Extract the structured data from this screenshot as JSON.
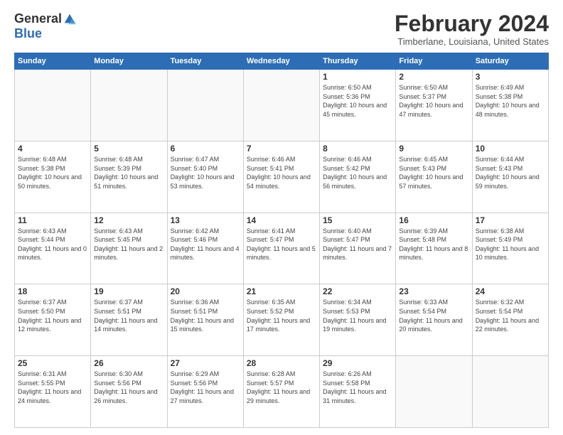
{
  "logo": {
    "general": "General",
    "blue": "Blue"
  },
  "title": "February 2024",
  "subtitle": "Timberlane, Louisiana, United States",
  "headers": [
    "Sunday",
    "Monday",
    "Tuesday",
    "Wednesday",
    "Thursday",
    "Friday",
    "Saturday"
  ],
  "weeks": [
    [
      {
        "day": "",
        "info": ""
      },
      {
        "day": "",
        "info": ""
      },
      {
        "day": "",
        "info": ""
      },
      {
        "day": "",
        "info": ""
      },
      {
        "day": "1",
        "info": "Sunrise: 6:50 AM\nSunset: 5:36 PM\nDaylight: 10 hours\nand 45 minutes."
      },
      {
        "day": "2",
        "info": "Sunrise: 6:50 AM\nSunset: 5:37 PM\nDaylight: 10 hours\nand 47 minutes."
      },
      {
        "day": "3",
        "info": "Sunrise: 6:49 AM\nSunset: 5:38 PM\nDaylight: 10 hours\nand 48 minutes."
      }
    ],
    [
      {
        "day": "4",
        "info": "Sunrise: 6:48 AM\nSunset: 5:38 PM\nDaylight: 10 hours\nand 50 minutes."
      },
      {
        "day": "5",
        "info": "Sunrise: 6:48 AM\nSunset: 5:39 PM\nDaylight: 10 hours\nand 51 minutes."
      },
      {
        "day": "6",
        "info": "Sunrise: 6:47 AM\nSunset: 5:40 PM\nDaylight: 10 hours\nand 53 minutes."
      },
      {
        "day": "7",
        "info": "Sunrise: 6:46 AM\nSunset: 5:41 PM\nDaylight: 10 hours\nand 54 minutes."
      },
      {
        "day": "8",
        "info": "Sunrise: 6:46 AM\nSunset: 5:42 PM\nDaylight: 10 hours\nand 56 minutes."
      },
      {
        "day": "9",
        "info": "Sunrise: 6:45 AM\nSunset: 5:43 PM\nDaylight: 10 hours\nand 57 minutes."
      },
      {
        "day": "10",
        "info": "Sunrise: 6:44 AM\nSunset: 5:43 PM\nDaylight: 10 hours\nand 59 minutes."
      }
    ],
    [
      {
        "day": "11",
        "info": "Sunrise: 6:43 AM\nSunset: 5:44 PM\nDaylight: 11 hours\nand 0 minutes."
      },
      {
        "day": "12",
        "info": "Sunrise: 6:43 AM\nSunset: 5:45 PM\nDaylight: 11 hours\nand 2 minutes."
      },
      {
        "day": "13",
        "info": "Sunrise: 6:42 AM\nSunset: 5:46 PM\nDaylight: 11 hours\nand 4 minutes."
      },
      {
        "day": "14",
        "info": "Sunrise: 6:41 AM\nSunset: 5:47 PM\nDaylight: 11 hours\nand 5 minutes."
      },
      {
        "day": "15",
        "info": "Sunrise: 6:40 AM\nSunset: 5:47 PM\nDaylight: 11 hours\nand 7 minutes."
      },
      {
        "day": "16",
        "info": "Sunrise: 6:39 AM\nSunset: 5:48 PM\nDaylight: 11 hours\nand 8 minutes."
      },
      {
        "day": "17",
        "info": "Sunrise: 6:38 AM\nSunset: 5:49 PM\nDaylight: 11 hours\nand 10 minutes."
      }
    ],
    [
      {
        "day": "18",
        "info": "Sunrise: 6:37 AM\nSunset: 5:50 PM\nDaylight: 11 hours\nand 12 minutes."
      },
      {
        "day": "19",
        "info": "Sunrise: 6:37 AM\nSunset: 5:51 PM\nDaylight: 11 hours\nand 14 minutes."
      },
      {
        "day": "20",
        "info": "Sunrise: 6:36 AM\nSunset: 5:51 PM\nDaylight: 11 hours\nand 15 minutes."
      },
      {
        "day": "21",
        "info": "Sunrise: 6:35 AM\nSunset: 5:52 PM\nDaylight: 11 hours\nand 17 minutes."
      },
      {
        "day": "22",
        "info": "Sunrise: 6:34 AM\nSunset: 5:53 PM\nDaylight: 11 hours\nand 19 minutes."
      },
      {
        "day": "23",
        "info": "Sunrise: 6:33 AM\nSunset: 5:54 PM\nDaylight: 11 hours\nand 20 minutes."
      },
      {
        "day": "24",
        "info": "Sunrise: 6:32 AM\nSunset: 5:54 PM\nDaylight: 11 hours\nand 22 minutes."
      }
    ],
    [
      {
        "day": "25",
        "info": "Sunrise: 6:31 AM\nSunset: 5:55 PM\nDaylight: 11 hours\nand 24 minutes."
      },
      {
        "day": "26",
        "info": "Sunrise: 6:30 AM\nSunset: 5:56 PM\nDaylight: 11 hours\nand 26 minutes."
      },
      {
        "day": "27",
        "info": "Sunrise: 6:29 AM\nSunset: 5:56 PM\nDaylight: 11 hours\nand 27 minutes."
      },
      {
        "day": "28",
        "info": "Sunrise: 6:28 AM\nSunset: 5:57 PM\nDaylight: 11 hours\nand 29 minutes."
      },
      {
        "day": "29",
        "info": "Sunrise: 6:26 AM\nSunset: 5:58 PM\nDaylight: 11 hours\nand 31 minutes."
      },
      {
        "day": "",
        "info": ""
      },
      {
        "day": "",
        "info": ""
      }
    ]
  ]
}
